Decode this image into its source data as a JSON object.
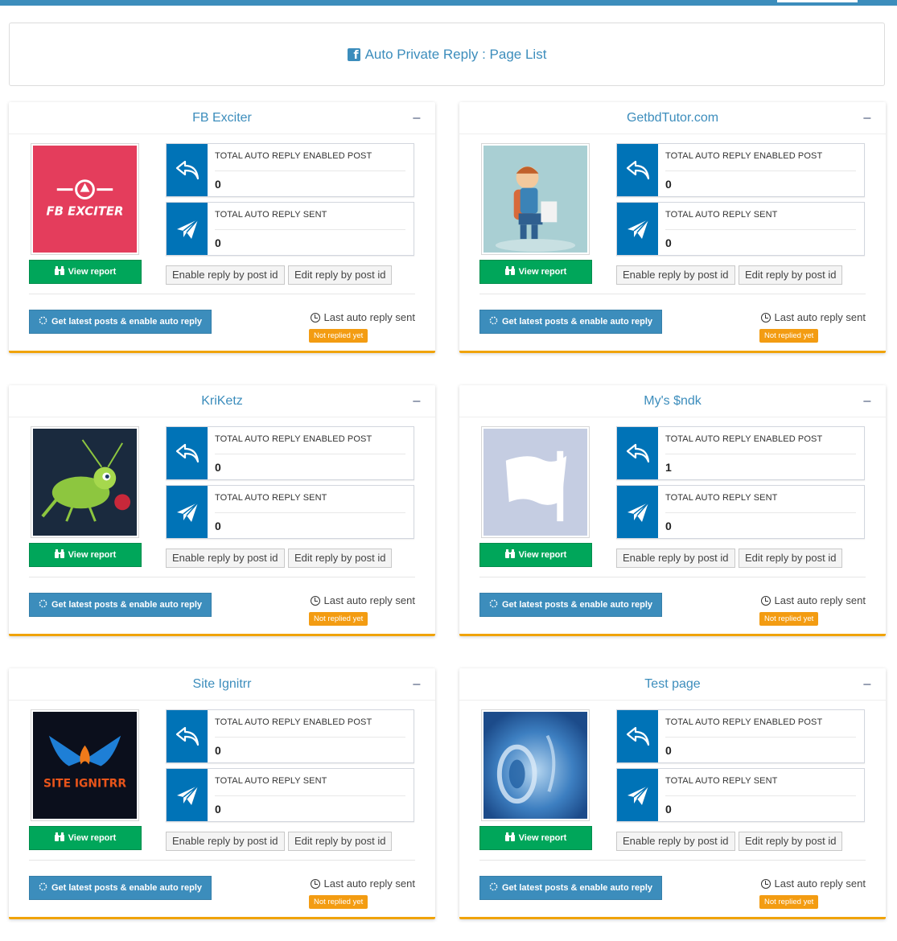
{
  "header": {
    "icon": "facebook-icon",
    "title": "Auto Private Reply : Page List"
  },
  "labels": {
    "enabled_post": "TOTAL AUTO REPLY ENABLED POST",
    "reply_sent": "TOTAL AUTO REPLY SENT",
    "view_report": "View report",
    "enable_by_post": "Enable reply by post id",
    "edit_by_post": "Edit reply by post id",
    "get_latest": "Get latest posts & enable auto reply",
    "last_sent": "Last auto reply sent",
    "not_replied": "Not replied yet",
    "collapse": "−"
  },
  "colors": {
    "primary": "#3c8dbc",
    "success": "#00a65a",
    "info_box": "#0073b7",
    "warning": "#f39c12",
    "card_border": "#f0a30a"
  },
  "pages": [
    {
      "name": "FB Exciter",
      "avatar": "fb-exciter-logo",
      "avatar_text": "FB EXCITER",
      "enabled_posts": "0",
      "replies_sent": "0"
    },
    {
      "name": "GetbdTutor.com",
      "avatar": "student-illustration",
      "avatar_text": "",
      "enabled_posts": "0",
      "replies_sent": "0"
    },
    {
      "name": "KriKetz",
      "avatar": "cricket-insect-logo",
      "avatar_text": "",
      "enabled_posts": "0",
      "replies_sent": "0"
    },
    {
      "name": "My's $ndk",
      "avatar": "default-flag-avatar",
      "avatar_text": "",
      "enabled_posts": "1",
      "replies_sent": "0"
    },
    {
      "name": "Site Ignitrr",
      "avatar": "site-ignitrr-logo",
      "avatar_text": "SITE IGNITRR",
      "enabled_posts": "0",
      "replies_sent": "0"
    },
    {
      "name": "Test page",
      "avatar": "blue-abstract-image",
      "avatar_text": "",
      "enabled_posts": "0",
      "replies_sent": "0"
    }
  ]
}
